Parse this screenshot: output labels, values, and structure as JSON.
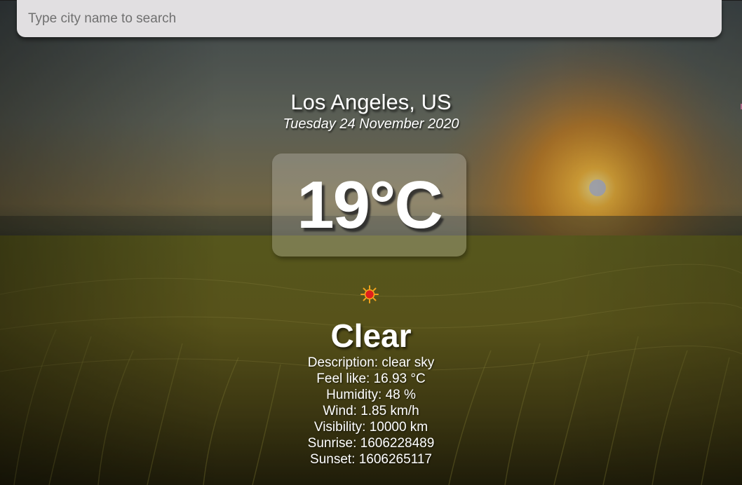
{
  "search": {
    "placeholder": "Type city name to search",
    "value": ""
  },
  "weather": {
    "location": "Los Angeles, US",
    "date": "Tuesday 24 November 2020",
    "temperature": "19°C",
    "icon": "sun-icon",
    "condition": "Clear",
    "details": {
      "description": "Description: clear sky",
      "feels_like": "Feel like: 16.93 °C",
      "humidity": "Humidity: 48 %",
      "wind": "Wind: 1.85 km/h",
      "visibility": "Visibility: 10000 km",
      "sunrise": "Sunrise: 1606228489",
      "sunset": "Sunset: 1606265117"
    }
  },
  "colors": {
    "search_bg": "#e1dfe1",
    "text": "#ffffff",
    "sky_top": "#5a646a",
    "sun_glow": "#f4a020",
    "field": "#5f5a1c"
  }
}
